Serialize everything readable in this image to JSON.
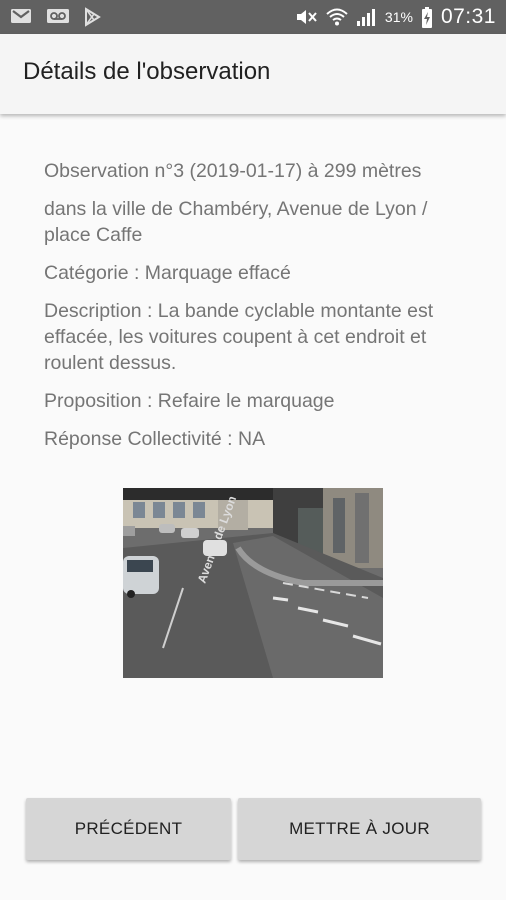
{
  "status_bar": {
    "battery_percent": "31%",
    "time": "07:31",
    "left_icons": [
      "gmail-icon",
      "voicemail-icon",
      "play-store-icon"
    ],
    "right_icons": [
      "mute-icon",
      "wifi-icon",
      "signal-icon",
      "battery-charging-icon"
    ]
  },
  "app_bar": {
    "title": "Détails de l'observation"
  },
  "observation": {
    "header": "Observation n°3 (2019-01-17) à 299 mètres",
    "location": "dans la ville de Chambéry, Avenue de Lyon / place Caffe",
    "category": "Catégorie : Marquage effacé",
    "description": "Description : La bande cyclable montante est effacée, les voitures coupent à cet endroit et roulent dessus.",
    "proposal": "Proposition : Refaire le marquage",
    "response": "Réponse Collectivité : NA"
  },
  "photo": {
    "street_text": "Avenue de Lyon"
  },
  "buttons": {
    "previous": "PRÉCÉDENT",
    "update": "METTRE À JOUR"
  }
}
